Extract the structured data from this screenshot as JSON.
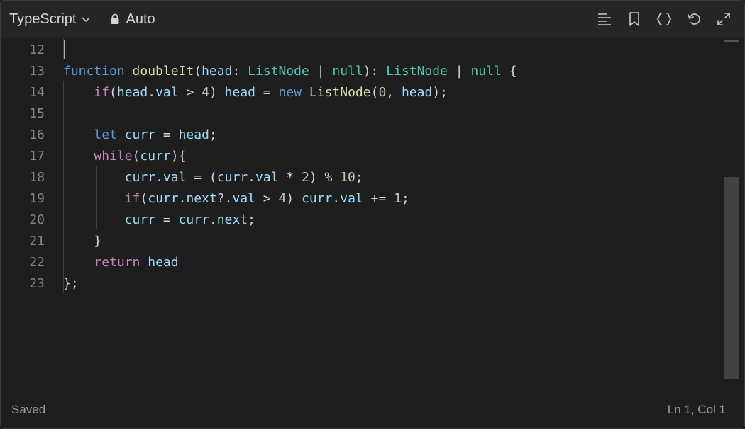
{
  "toolbar": {
    "language": "TypeScript",
    "mode": "Auto",
    "icons": [
      "chevron-down-icon",
      "lock-icon",
      "format-align-icon",
      "bookmark-icon",
      "braces-icon",
      "undo-icon",
      "expand-icon"
    ]
  },
  "editor": {
    "lines": [
      {
        "num": "12",
        "tokens": []
      },
      {
        "num": "13",
        "tokens": [
          {
            "t": "function",
            "c": "keyword"
          },
          {
            "t": " ",
            "c": "plain"
          },
          {
            "t": "doubleIt",
            "c": "func"
          },
          {
            "t": "(",
            "c": "plain"
          },
          {
            "t": "head",
            "c": "param"
          },
          {
            "t": ": ",
            "c": "plain"
          },
          {
            "t": "ListNode",
            "c": "type"
          },
          {
            "t": " | ",
            "c": "plain"
          },
          {
            "t": "null",
            "c": "type"
          },
          {
            "t": "): ",
            "c": "plain"
          },
          {
            "t": "ListNode",
            "c": "type"
          },
          {
            "t": " | ",
            "c": "plain"
          },
          {
            "t": "null",
            "c": "type"
          },
          {
            "t": " {",
            "c": "plain"
          }
        ]
      },
      {
        "num": "14",
        "tokens": [
          {
            "t": "    ",
            "c": "plain"
          },
          {
            "t": "if",
            "c": "control"
          },
          {
            "t": "(",
            "c": "plain"
          },
          {
            "t": "head",
            "c": "param"
          },
          {
            "t": ".",
            "c": "plain"
          },
          {
            "t": "val",
            "c": "param"
          },
          {
            "t": " > ",
            "c": "plain"
          },
          {
            "t": "4",
            "c": "number"
          },
          {
            "t": ") ",
            "c": "plain"
          },
          {
            "t": "head",
            "c": "param"
          },
          {
            "t": " = ",
            "c": "plain"
          },
          {
            "t": "new",
            "c": "keyword"
          },
          {
            "t": " ",
            "c": "plain"
          },
          {
            "t": "ListNode",
            "c": "func"
          },
          {
            "t": "(",
            "c": "plain"
          },
          {
            "t": "0",
            "c": "number"
          },
          {
            "t": ", ",
            "c": "plain"
          },
          {
            "t": "head",
            "c": "param"
          },
          {
            "t": ");",
            "c": "plain"
          }
        ]
      },
      {
        "num": "15",
        "tokens": []
      },
      {
        "num": "16",
        "tokens": [
          {
            "t": "    ",
            "c": "plain"
          },
          {
            "t": "let",
            "c": "keyword"
          },
          {
            "t": " ",
            "c": "plain"
          },
          {
            "t": "curr",
            "c": "param"
          },
          {
            "t": " = ",
            "c": "plain"
          },
          {
            "t": "head",
            "c": "param"
          },
          {
            "t": ";",
            "c": "plain"
          }
        ]
      },
      {
        "num": "17",
        "tokens": [
          {
            "t": "    ",
            "c": "plain"
          },
          {
            "t": "while",
            "c": "control"
          },
          {
            "t": "(",
            "c": "plain"
          },
          {
            "t": "curr",
            "c": "param"
          },
          {
            "t": "){",
            "c": "plain"
          }
        ]
      },
      {
        "num": "18",
        "tokens": [
          {
            "t": "        ",
            "c": "plain"
          },
          {
            "t": "curr",
            "c": "param"
          },
          {
            "t": ".",
            "c": "plain"
          },
          {
            "t": "val",
            "c": "param"
          },
          {
            "t": " = (",
            "c": "plain"
          },
          {
            "t": "curr",
            "c": "param"
          },
          {
            "t": ".",
            "c": "plain"
          },
          {
            "t": "val",
            "c": "param"
          },
          {
            "t": " * ",
            "c": "plain"
          },
          {
            "t": "2",
            "c": "number"
          },
          {
            "t": ") % ",
            "c": "plain"
          },
          {
            "t": "10",
            "c": "number"
          },
          {
            "t": ";",
            "c": "plain"
          }
        ]
      },
      {
        "num": "19",
        "tokens": [
          {
            "t": "        ",
            "c": "plain"
          },
          {
            "t": "if",
            "c": "control"
          },
          {
            "t": "(",
            "c": "plain"
          },
          {
            "t": "curr",
            "c": "param"
          },
          {
            "t": ".",
            "c": "plain"
          },
          {
            "t": "next",
            "c": "param"
          },
          {
            "t": "?.",
            "c": "plain"
          },
          {
            "t": "val",
            "c": "param"
          },
          {
            "t": " > ",
            "c": "plain"
          },
          {
            "t": "4",
            "c": "number"
          },
          {
            "t": ") ",
            "c": "plain"
          },
          {
            "t": "curr",
            "c": "param"
          },
          {
            "t": ".",
            "c": "plain"
          },
          {
            "t": "val",
            "c": "param"
          },
          {
            "t": " += ",
            "c": "plain"
          },
          {
            "t": "1",
            "c": "number"
          },
          {
            "t": ";",
            "c": "plain"
          }
        ]
      },
      {
        "num": "20",
        "tokens": [
          {
            "t": "        ",
            "c": "plain"
          },
          {
            "t": "curr",
            "c": "param"
          },
          {
            "t": " = ",
            "c": "plain"
          },
          {
            "t": "curr",
            "c": "param"
          },
          {
            "t": ".",
            "c": "plain"
          },
          {
            "t": "next",
            "c": "param"
          },
          {
            "t": ";",
            "c": "plain"
          }
        ]
      },
      {
        "num": "21",
        "tokens": [
          {
            "t": "    ",
            "c": "plain"
          },
          {
            "t": "}",
            "c": "plain"
          }
        ]
      },
      {
        "num": "22",
        "tokens": [
          {
            "t": "    ",
            "c": "plain"
          },
          {
            "t": "return",
            "c": "control"
          },
          {
            "t": " ",
            "c": "plain"
          },
          {
            "t": "head",
            "c": "param"
          }
        ]
      },
      {
        "num": "23",
        "tokens": [
          {
            "t": "};",
            "c": "plain"
          }
        ]
      }
    ]
  },
  "status": {
    "left": "Saved",
    "right": "Ln 1, Col 1"
  },
  "colors": {
    "background": "#1e1e1e",
    "keyword": "#569cd6",
    "control": "#c586c0",
    "function": "#dcdcaa",
    "variable": "#9cdcfe",
    "type": "#4ec9b0",
    "number": "#b5cea8"
  }
}
